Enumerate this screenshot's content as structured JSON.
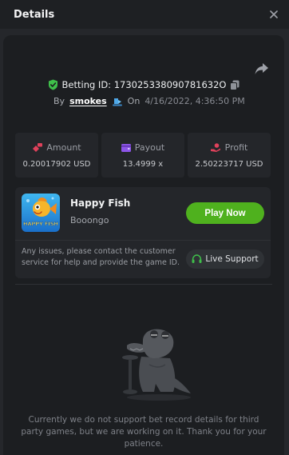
{
  "header": {
    "title": "Details"
  },
  "bet": {
    "id_label": "Betting ID: 173025338090781632O",
    "by_label": "By",
    "user": "smokes",
    "on_label": "On",
    "datetime": "4/16/2022, 4:36:50 PM"
  },
  "stats": [
    {
      "label": "Amount",
      "value": "0.20017902 USD",
      "icon": "coins-icon",
      "color": "#e0415b"
    },
    {
      "label": "Payout",
      "value": "13.4999 x",
      "icon": "wallet-icon",
      "color": "#8d55e8"
    },
    {
      "label": "Profit",
      "value": "2.50223717 USD",
      "icon": "profit-icon",
      "color": "#e0415b"
    }
  ],
  "game": {
    "name": "Happy Fish",
    "provider": "Booongo",
    "play_label": "Play Now",
    "thumb_text": "HAPPY FISH",
    "notice": "Any issues, please contact the customer service for help and provide the game ID.",
    "support_label": "Live Support"
  },
  "empty_state": {
    "message": "Currently we do not support bet record details for third party games, but we are working on it. Thank you for your patience."
  },
  "colors": {
    "accent_green": "#4fb11e",
    "check_green": "#3fbf4a"
  }
}
